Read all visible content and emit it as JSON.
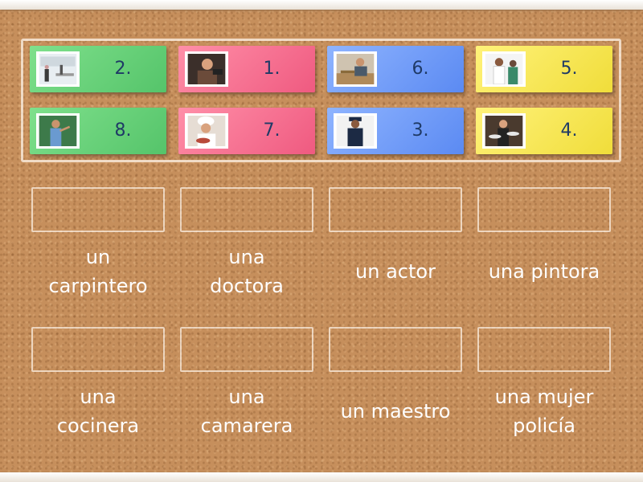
{
  "cards": [
    {
      "number": "2.",
      "color": "green",
      "icon": "school-classroom-photo"
    },
    {
      "number": "1.",
      "color": "pink",
      "icon": "actor-photo"
    },
    {
      "number": "6.",
      "color": "blue",
      "icon": "carpenter-photo"
    },
    {
      "number": "5.",
      "color": "yellow",
      "icon": "doctor-photo"
    },
    {
      "number": "8.",
      "color": "green",
      "icon": "teacher-photo"
    },
    {
      "number": "7.",
      "color": "pink",
      "icon": "chef-photo"
    },
    {
      "number": "3.",
      "color": "blue",
      "icon": "police-officer-photo"
    },
    {
      "number": "4.",
      "color": "yellow",
      "icon": "waitress-photo"
    }
  ],
  "answers": [
    {
      "line1": "un",
      "line2": "carpintero"
    },
    {
      "line1": "una",
      "line2": "doctora"
    },
    {
      "line1": "un actor",
      "line2": ""
    },
    {
      "line1": "una pintora",
      "line2": ""
    },
    {
      "line1": "una",
      "line2": "cocinera"
    },
    {
      "line1": "una",
      "line2": "camarera"
    },
    {
      "line1": "un maestro",
      "line2": ""
    },
    {
      "line1": "una mujer",
      "line2": "policía"
    }
  ]
}
